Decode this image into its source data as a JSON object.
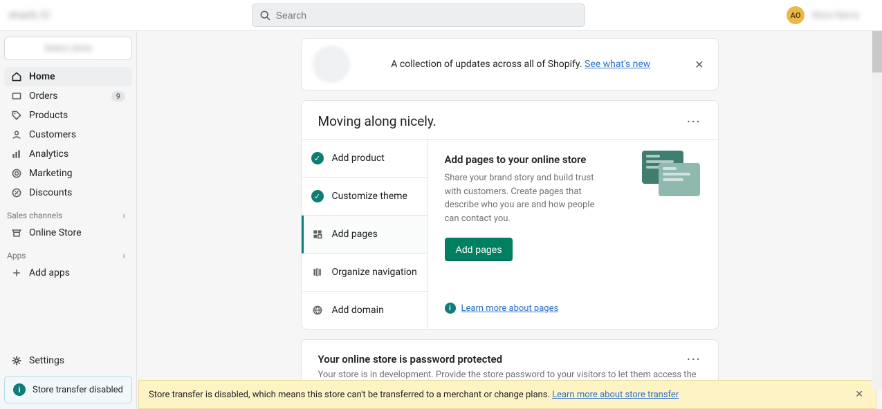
{
  "topbar": {
    "left_blur_text": "shopify 22",
    "search_placeholder": "Search",
    "avatar_initials": "AO",
    "store_name_blur": "Store Name"
  },
  "sidebar": {
    "store_switch_blur": "Select store",
    "items": [
      {
        "label": "Home",
        "icon": "home-icon",
        "active": true
      },
      {
        "label": "Orders",
        "icon": "orders-icon",
        "badge": "9"
      },
      {
        "label": "Products",
        "icon": "products-icon"
      },
      {
        "label": "Customers",
        "icon": "customers-icon"
      },
      {
        "label": "Analytics",
        "icon": "analytics-icon"
      },
      {
        "label": "Marketing",
        "icon": "marketing-icon"
      },
      {
        "label": "Discounts",
        "icon": "discounts-icon"
      }
    ],
    "section_sales": "Sales channels",
    "online_store": "Online Store",
    "section_apps": "Apps",
    "add_apps": "Add apps",
    "settings": "Settings",
    "disabled_notice": "Store transfer disabled"
  },
  "update_bar": {
    "text": "A collection of updates across all of Shopify. ",
    "link": "See what's new"
  },
  "setup_card": {
    "title": "Moving along nicely.",
    "steps": [
      {
        "label": "Add product",
        "done": true
      },
      {
        "label": "Customize theme",
        "done": true
      },
      {
        "label": "Add pages",
        "selected": true
      },
      {
        "label": "Organize navigation"
      },
      {
        "label": "Add domain"
      }
    ],
    "detail": {
      "title": "Add pages to your online store",
      "desc": "Share your brand story and build trust with customers. Create pages that describe who you are and how people can contact you.",
      "button": "Add pages",
      "learn": "Learn more about pages"
    }
  },
  "password_card": {
    "title": "Your online store is password protected",
    "body": "Your store is in development. Provide the store password to your visitors to let them access the store."
  },
  "banner": {
    "text": "Store transfer is disabled, which means this store can't be transferred to a merchant or change plans. ",
    "link": "Learn more about store transfer"
  }
}
